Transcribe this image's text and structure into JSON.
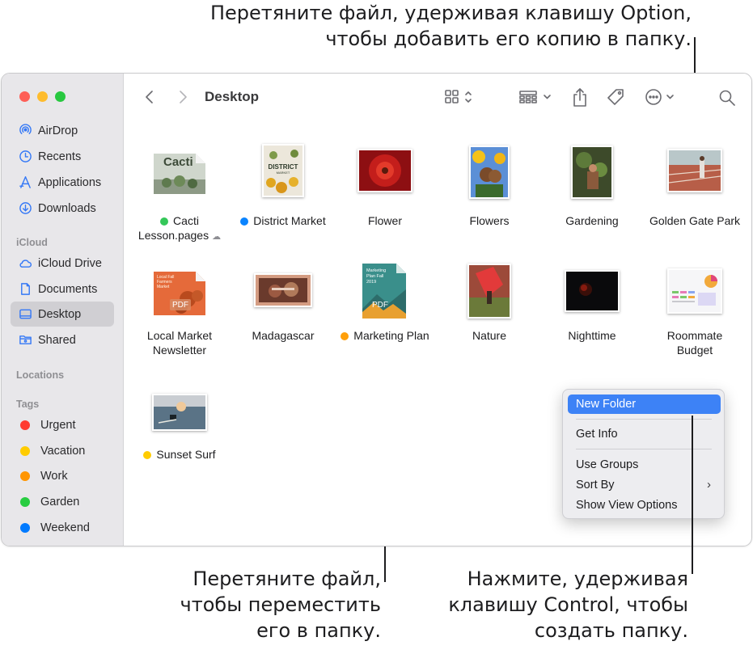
{
  "callouts": {
    "top_line1": "Перетяните файл, удерживая клавишу Option,",
    "top_line2": "чтобы добавить его копию в папку.",
    "left_line1": "Перетяните файл,",
    "left_line2": "чтобы переместить",
    "left_line3": "его в папку.",
    "right_line1": "Нажмите, удерживая",
    "right_line2": "клавишу Control, чтобы",
    "right_line3": "создать папку."
  },
  "window": {
    "title": "Desktop"
  },
  "sidebar": {
    "favorites": [
      {
        "label": "AirDrop",
        "icon": "airdrop-icon"
      },
      {
        "label": "Recents",
        "icon": "clock-icon"
      },
      {
        "label": "Applications",
        "icon": "applications-icon"
      },
      {
        "label": "Downloads",
        "icon": "download-icon"
      }
    ],
    "icloud_header": "iCloud",
    "icloud": [
      {
        "label": "iCloud Drive",
        "icon": "cloud-icon"
      },
      {
        "label": "Documents",
        "icon": "document-icon"
      },
      {
        "label": "Desktop",
        "icon": "desktop-icon",
        "selected": true
      },
      {
        "label": "Shared",
        "icon": "shared-folder-icon"
      }
    ],
    "locations_header": "Locations",
    "tags_header": "Tags",
    "tags": [
      {
        "label": "Urgent",
        "color": "#ff3b30"
      },
      {
        "label": "Vacation",
        "color": "#ffcc00"
      },
      {
        "label": "Work",
        "color": "#ff9500"
      },
      {
        "label": "Garden",
        "color": "#28cd41"
      },
      {
        "label": "Weekend",
        "color": "#007aff"
      }
    ]
  },
  "files": [
    {
      "name_line1": "Cacti",
      "name_line2": "Lesson.pages",
      "tag_color": "#34c759",
      "cloud": true
    },
    {
      "name_line1": "District Market",
      "tag_color": "#0a84ff"
    },
    {
      "name_line1": "Flower"
    },
    {
      "name_line1": "Flowers"
    },
    {
      "name_line1": "Gardening"
    },
    {
      "name_line1": "Golden Gate Park"
    },
    {
      "name_line1": "Local Market",
      "name_line2": "Newsletter"
    },
    {
      "name_line1": "Madagascar"
    },
    {
      "name_line1": "Marketing Plan",
      "tag_color": "#ff9f0a"
    },
    {
      "name_line1": "Nature"
    },
    {
      "name_line1": "Nighttime"
    },
    {
      "name_line1": "Roommate",
      "name_line2": "Budget"
    },
    {
      "name_line1": "Sunset Surf",
      "tag_color": "#ffcc00"
    }
  ],
  "thumb_texts": {
    "cacti": "Cacti",
    "district": "DISTRICT",
    "district_sub": "MARKET",
    "local_market": "Local Fall Farmers Market",
    "pdf": "PDF",
    "marketing": "Marketing Plan Fall 2019"
  },
  "context_menu": {
    "new_folder": "New Folder",
    "get_info": "Get Info",
    "use_groups": "Use Groups",
    "sort_by": "Sort By",
    "show_view_options": "Show View Options"
  },
  "colors": {
    "accent": "#3d82f6",
    "sidebar_bg": "#e8e7ea"
  }
}
